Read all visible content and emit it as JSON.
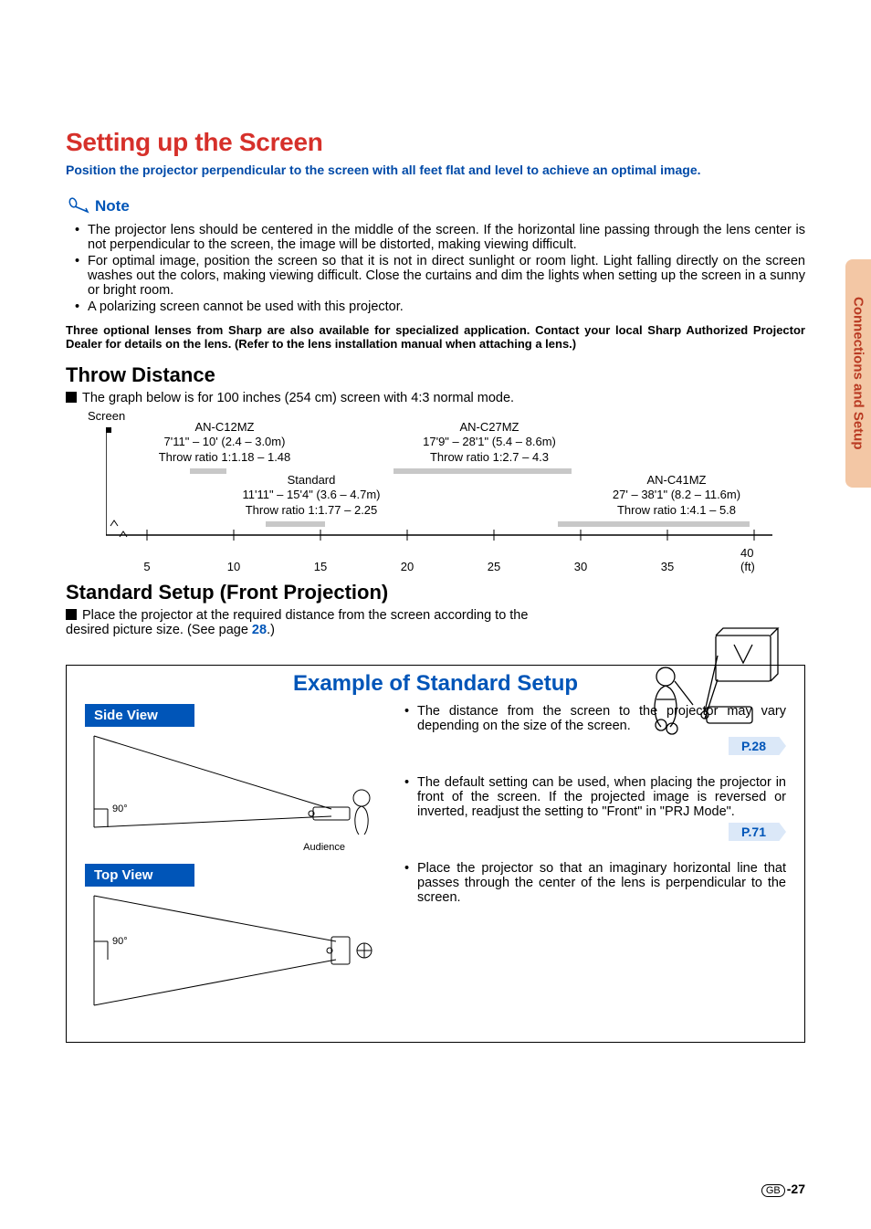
{
  "sideTab": "Connections and Setup",
  "h1": "Setting up the Screen",
  "lead": "Position the projector perpendicular to the screen with all feet flat and level to achieve an optimal image.",
  "noteLabel": "Note",
  "notes": [
    "The projector lens should be centered in the middle of the screen. If the horizontal line passing through the lens center is not perpendicular to the screen, the image will be distorted, making viewing difficult.",
    "For optimal image, position the screen so that it is not in direct sunlight or room light. Light falling directly on the screen washes out the colors, making viewing difficult. Close the curtains and dim the lights when setting up the screen in a sunny or bright room.",
    "A polarizing screen cannot be used with this projector."
  ],
  "lensNote": "Three optional lenses from Sharp are also available for specialized application. Contact your local Sharp Authorized Projector Dealer for details on the lens. (Refer to the lens installation manual when attaching a lens.)",
  "throw": {
    "heading": "Throw Distance",
    "intro": "The graph below is for 100 inches (254 cm) screen with 4:3 normal mode.",
    "screenLabel": "Screen",
    "unit": "(ft)",
    "ticks": [
      "5",
      "10",
      "15",
      "20",
      "25",
      "30",
      "35",
      "40"
    ],
    "lenses": [
      {
        "name": "AN-C12MZ",
        "range": "7'11\" – 10' (2.4 – 3.0m)",
        "ratio": "Throw ratio 1:1.18 – 1.48"
      },
      {
        "name": "AN-C27MZ",
        "range": "17'9\" – 28'1\" (5.4 – 8.6m)",
        "ratio": "Throw ratio 1:2.7 – 4.3"
      },
      {
        "name": "Standard",
        "range": "11'11\" – 15'4\" (3.6 – 4.7m)",
        "ratio": "Throw ratio 1:1.77 – 2.25"
      },
      {
        "name": "AN-C41MZ",
        "range": "27' – 38'1\" (8.2 – 11.6m)",
        "ratio": "Throw ratio 1:4.1 – 5.8"
      }
    ]
  },
  "standardSetup": {
    "heading": "Standard Setup (Front Projection)",
    "body": "Place the projector at the required distance from the screen according to the desired picture size. (See page ",
    "xref": "28",
    "bodyEnd": ".)"
  },
  "example": {
    "title": "Example of Standard Setup",
    "sideView": "Side View",
    "topView": "Top View",
    "angle": "90°",
    "audience": "Audience",
    "items": [
      {
        "text": "The distance from the screen to the projector may vary depending on the size of the screen.",
        "ref": "P.28"
      },
      {
        "text": "The default setting can be used, when placing the projector in front of the screen. If the projected image is reversed or inverted, readjust the setting to \"Front\" in \"PRJ Mode\".",
        "ref": "P.71"
      },
      {
        "text": "Place the projector so that an imaginary horizontal line that passes through the center of the lens is perpendicular to the screen.",
        "ref": null
      }
    ]
  },
  "footer": {
    "region": "GB",
    "page": "-27"
  },
  "chart_data": {
    "type": "bar",
    "title": "Throw Distance for 100-inch (254 cm) screen, 4:3 normal mode",
    "xlabel": "Distance (ft)",
    "ylabel": "",
    "xlim": [
      0,
      40
    ],
    "series": [
      {
        "name": "AN-C12MZ",
        "range_ft": [
          7.92,
          10.0
        ],
        "range_m": [
          2.4,
          3.0
        ],
        "throw_ratio": [
          1.18,
          1.48
        ]
      },
      {
        "name": "Standard",
        "range_ft": [
          11.92,
          15.33
        ],
        "range_m": [
          3.6,
          4.7
        ],
        "throw_ratio": [
          1.77,
          2.25
        ]
      },
      {
        "name": "AN-C27MZ",
        "range_ft": [
          17.75,
          28.08
        ],
        "range_m": [
          5.4,
          8.6
        ],
        "throw_ratio": [
          2.7,
          4.3
        ]
      },
      {
        "name": "AN-C41MZ",
        "range_ft": [
          27.0,
          38.08
        ],
        "range_m": [
          8.2,
          11.6
        ],
        "throw_ratio": [
          4.1,
          5.8
        ]
      }
    ],
    "ticks": [
      5,
      10,
      15,
      20,
      25,
      30,
      35,
      40
    ]
  }
}
